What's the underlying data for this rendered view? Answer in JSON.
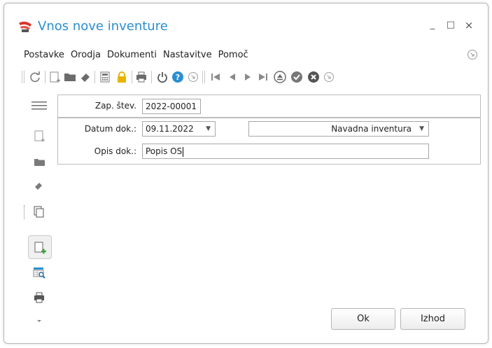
{
  "window": {
    "title": "Vnos nove inventure",
    "minimize": "_",
    "maximize": "□",
    "close": "×"
  },
  "menu": [
    {
      "label": "Postavke"
    },
    {
      "label": "Orodja"
    },
    {
      "label": "Dokumenti"
    },
    {
      "label": "Nastavitve"
    },
    {
      "label": "Pomoč"
    }
  ],
  "toolbar_icons": [
    "refresh-icon",
    "new-document-icon",
    "open-folder-icon",
    "eraser-icon",
    "calculator-icon",
    "lock-icon",
    "print-icon",
    "power-icon",
    "help-icon",
    "expand-icon",
    "first-record-icon",
    "previous-record-icon",
    "next-record-icon",
    "last-record-icon",
    "eject-icon",
    "confirm-icon",
    "cancel-icon",
    "more-icon"
  ],
  "side_icons": [
    "hamburger-menu-icon",
    "new-document-icon",
    "open-folder-icon",
    "eraser-icon",
    "copy-icon",
    "add-document-icon",
    "find-table-icon",
    "print-icon",
    "dropdown-arrow-icon"
  ],
  "form": {
    "doc_number_label": "Zap. štev.",
    "doc_number_value": "2022-00001",
    "date_label": "Datum dok.:",
    "date_value": "09.11.2022",
    "type_value": "Navadna inventura",
    "description_label": "Opis dok.:",
    "description_value": "Popis OS"
  },
  "buttons": {
    "ok": "Ok",
    "exit": "Izhod"
  },
  "colors": {
    "title": "#2a8fd0",
    "help_blue": "#2a8fd0",
    "lock_yellow": "#e8b400",
    "add_green": "#3aa53a"
  }
}
